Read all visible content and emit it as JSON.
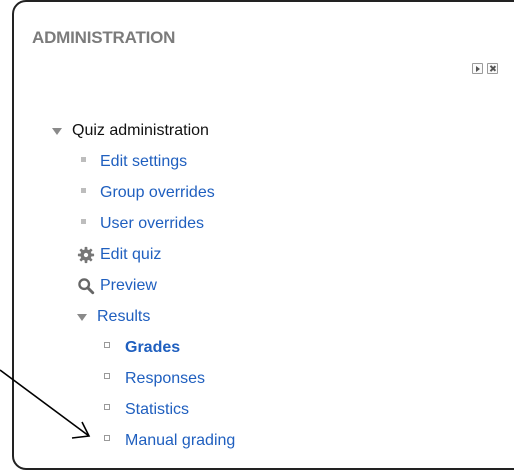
{
  "block": {
    "title": "ADMINISTRATION",
    "controls": {
      "dock_icon": "dock-icon",
      "close_icon": "close-icon"
    }
  },
  "tree": {
    "quiz_admin": {
      "label": "Quiz administration",
      "icon": "chevron-down-icon"
    },
    "edit_settings": {
      "label": "Edit settings",
      "icon": "bullet-square-filled"
    },
    "group_overrides": {
      "label": "Group overrides",
      "icon": "bullet-square-filled"
    },
    "user_overrides": {
      "label": "User overrides",
      "icon": "bullet-square-filled"
    },
    "edit_quiz": {
      "label": "Edit quiz",
      "icon": "gear-icon"
    },
    "preview": {
      "label": "Preview",
      "icon": "magnifier-icon"
    },
    "results": {
      "label": "Results",
      "icon": "chevron-down-icon",
      "children": {
        "grades": {
          "label": "Grades",
          "icon": "bullet-square-hollow",
          "current": true
        },
        "responses": {
          "label": "Responses",
          "icon": "bullet-square-hollow"
        },
        "statistics": {
          "label": "Statistics",
          "icon": "bullet-square-hollow"
        },
        "manual_grading": {
          "label": "Manual grading",
          "icon": "bullet-square-hollow"
        }
      }
    }
  },
  "colors": {
    "link": "#1f5fbf",
    "title": "#7b7b7b",
    "border": "#222222"
  },
  "annotation": {
    "type": "arrow",
    "points_to": "manual_grading"
  }
}
